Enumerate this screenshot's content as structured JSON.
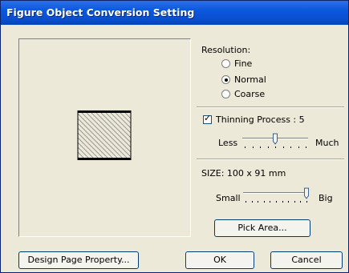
{
  "dialog": {
    "title": "Figure Object Conversion Setting"
  },
  "resolution": {
    "label": "Resolution:",
    "options": [
      {
        "label": "Fine",
        "selected": false
      },
      {
        "label": "Normal",
        "selected": true
      },
      {
        "label": "Coarse",
        "selected": false
      }
    ]
  },
  "thinning": {
    "checkbox_label": "Thinning Process : 5",
    "checked": true,
    "min_label": "Less",
    "max_label": "Much",
    "value": 5,
    "range": [
      1,
      9
    ]
  },
  "size": {
    "label": "SIZE:  100 x  91 mm",
    "min_label": "Small",
    "max_label": "Big",
    "value": 11,
    "range": [
      1,
      11
    ]
  },
  "buttons": {
    "pick_area": "Pick Area...",
    "design_page_property": "Design Page Property...",
    "ok": "OK",
    "cancel": "Cancel"
  },
  "icons": {
    "preview": "hatched-square-preview",
    "radio": "radio-button",
    "checkbox": "checkmark"
  },
  "colors": {
    "titlebar": "#0a58de",
    "dialog_bg": "#ece9d8",
    "button_border": "#003c74"
  }
}
